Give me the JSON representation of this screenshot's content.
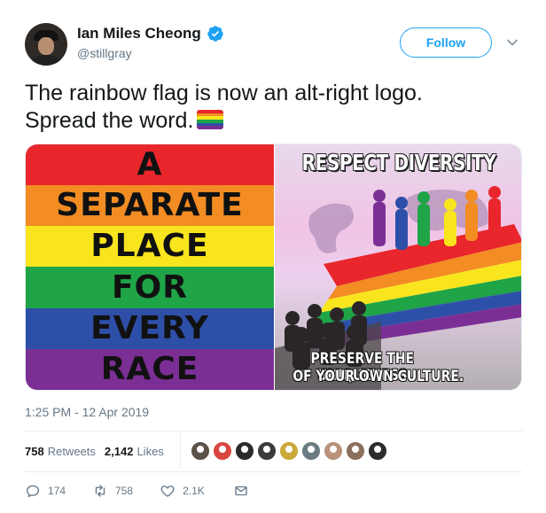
{
  "author": {
    "name": "Ian Miles Cheong",
    "handle": "@stillgray",
    "verified": true
  },
  "follow_label": "Follow",
  "tweet": {
    "text_line1": "The rainbow flag is now an alt-right logo.",
    "text_line2": "Spread the word.",
    "emoji": "rainbow-flag-icon"
  },
  "media": {
    "left_image": {
      "lines": [
        "A",
        "SEPARATE",
        "PLACE",
        "FOR",
        "EVERY",
        "RACE"
      ],
      "stripe_colors": [
        "#e8262c",
        "#f28c23",
        "#f9e51e",
        "#1fa447",
        "#2e4fa8",
        "#7b2f94"
      ]
    },
    "right_image": {
      "title": "RESPECT DIVERSITY",
      "caption_line1": "PRESERVE THE UNIQUENESS",
      "caption_line2": "OF YOUR OWN CULTURE."
    }
  },
  "timestamp": "1:25 PM - 12 Apr 2019",
  "stats": {
    "retweets_count": "758",
    "retweets_label": "Retweets",
    "likes_count": "2,142",
    "likes_label": "Likes"
  },
  "liker_avatars": [
    "#5a5147",
    "#d9463f",
    "#2a2a2a",
    "#3b3b3b",
    "#c9a93a",
    "#6b7a80",
    "#b99279",
    "#8a6f5c",
    "#2c2c2c"
  ],
  "actions": {
    "reply_count": "174",
    "retweet_count": "758",
    "like_count": "2.1K"
  },
  "colors": {
    "accent": "#1da1f2",
    "secondary_text": "#657786"
  }
}
